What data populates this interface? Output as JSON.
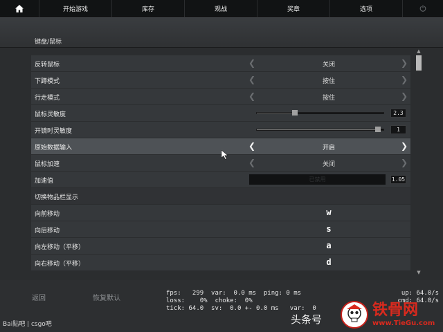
{
  "nav": {
    "tabs": [
      "开始游戏",
      "库存",
      "观战",
      "奖章",
      "选项"
    ]
  },
  "section": {
    "title": "键盘/鼠标"
  },
  "settings": {
    "invert_mouse": {
      "label": "反转鼠标",
      "value": "关闭"
    },
    "crouch_mode": {
      "label": "下蹲模式",
      "value": "按住"
    },
    "walk_mode": {
      "label": "行走模式",
      "value": "按住"
    },
    "mouse_sensitivity": {
      "label": "鼠标灵敏度",
      "value": "2.3",
      "level": 0.3
    },
    "zoom_sensitivity": {
      "label": "开镜时灵敏度",
      "value": "1",
      "level": 0.95
    },
    "raw_input": {
      "label": "原始数据输入",
      "value": "开启"
    },
    "mouse_accel": {
      "label": "鼠标加速",
      "value": "关闭"
    },
    "accel_value": {
      "label": "加速值",
      "placeholder": "已禁用",
      "value": "1.05"
    },
    "toggle_inventory": {
      "label": "切换物品栏显示"
    },
    "move_forward": {
      "label": "向前移动",
      "key": "w"
    },
    "move_back": {
      "label": "向后移动",
      "key": "s"
    },
    "move_left": {
      "label": "向左移动（平移）",
      "key": "a"
    },
    "move_right": {
      "label": "向右移动（平移）",
      "key": "d"
    }
  },
  "footer": {
    "back": "返回",
    "restore": "恢复默认",
    "netgraph_line1": "fps:   299  var:  0.0 ms  ping: 0 ms",
    "netgraph_line2": "loss:    0%  choke:  0%",
    "netgraph_line3": "tick: 64.0  sv:  0.0 +- 0.0 ms   var:  0",
    "netgraph_right1": "up: 64.0/s",
    "netgraph_right2": "cmd: 64.0/s"
  },
  "watermarks": {
    "baidu": "Bai贴吧 | csgo吧",
    "toutiao": "头条号",
    "logo_cn": "铁骨网",
    "logo_en": "www.TieGu.com"
  },
  "colors": {
    "accent_highlight": "#4e5256",
    "logo_red": "#d92a1e"
  }
}
